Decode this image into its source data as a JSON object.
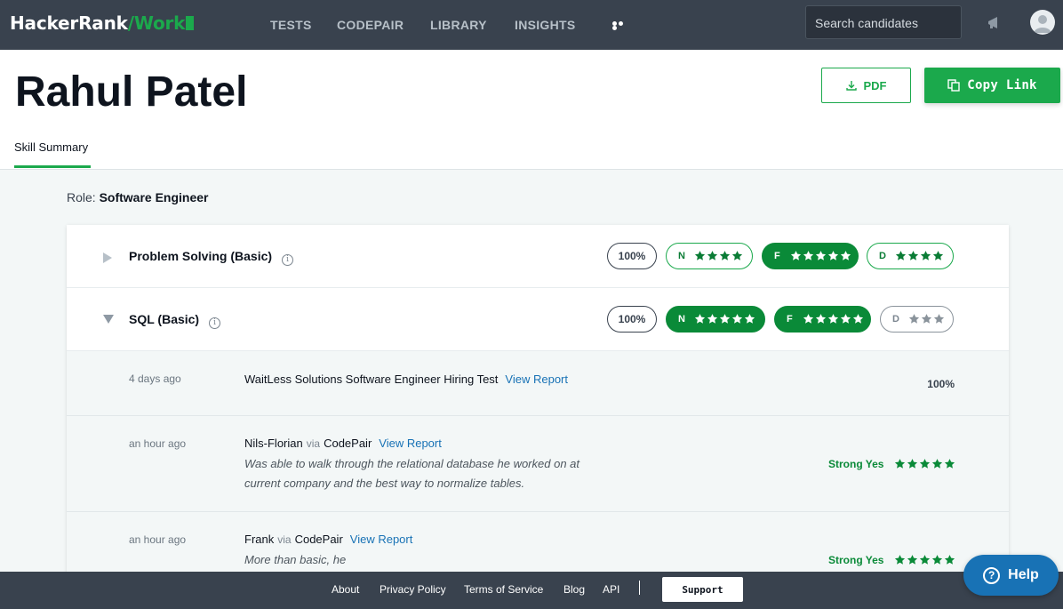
{
  "nav": {
    "logo_main": "HackerRank",
    "logo_accent": "/Work",
    "links": [
      "TESTS",
      "CODEPAIR",
      "LIBRARY",
      "INSIGHTS"
    ],
    "search_placeholder": "Search candidates"
  },
  "header": {
    "candidate_name": "Rahul Patel",
    "pdf_label": "PDF",
    "copy_link_label": "Copy Link",
    "tab_label": "Skill Summary"
  },
  "role": {
    "label": "Role:",
    "value": "Software Engineer"
  },
  "skills": [
    {
      "title": "Problem Solving (Basic)",
      "expanded": false,
      "percent": "100%",
      "ratings": [
        {
          "letter": "N",
          "stars": 4,
          "style": "outline"
        },
        {
          "letter": "F",
          "stars": 5,
          "style": "filled"
        },
        {
          "letter": "D",
          "stars": 4,
          "style": "outline"
        }
      ]
    },
    {
      "title": "SQL (Basic)",
      "expanded": true,
      "percent": "100%",
      "ratings": [
        {
          "letter": "N",
          "stars": 5,
          "style": "filled"
        },
        {
          "letter": "F",
          "stars": 5,
          "style": "filled"
        },
        {
          "letter": "D",
          "stars": 3,
          "style": "grey"
        }
      ],
      "entries": [
        {
          "when": "4 days ago",
          "title": "WaitLess Solutions Software Engineer Hiring Test",
          "link": "View Report",
          "score": "100%"
        },
        {
          "when": "an hour ago",
          "person": "Nils-Florian",
          "via": "via",
          "source": "CodePair",
          "link": "View Report",
          "note": "Was able to walk through the relational database he worked on at current company and the best way to normalize tables.",
          "verdict": "Strong Yes",
          "stars": 5
        },
        {
          "when": "an hour ago",
          "person": "Frank",
          "via": "via",
          "source": "CodePair",
          "link": "View Report",
          "note": "More than basic, he",
          "verdict": "Strong Yes",
          "stars": 5
        }
      ]
    }
  ],
  "footer": {
    "links": [
      "About",
      "Privacy Policy",
      "Terms of Service",
      "Blog",
      "API"
    ],
    "support_label": "Support"
  },
  "help_label": "Help",
  "colors": {
    "nav_bg": "#39424e",
    "accent_green": "#1ba94c",
    "link_blue": "#1872b5",
    "page_bg": "#f3f7f7"
  }
}
